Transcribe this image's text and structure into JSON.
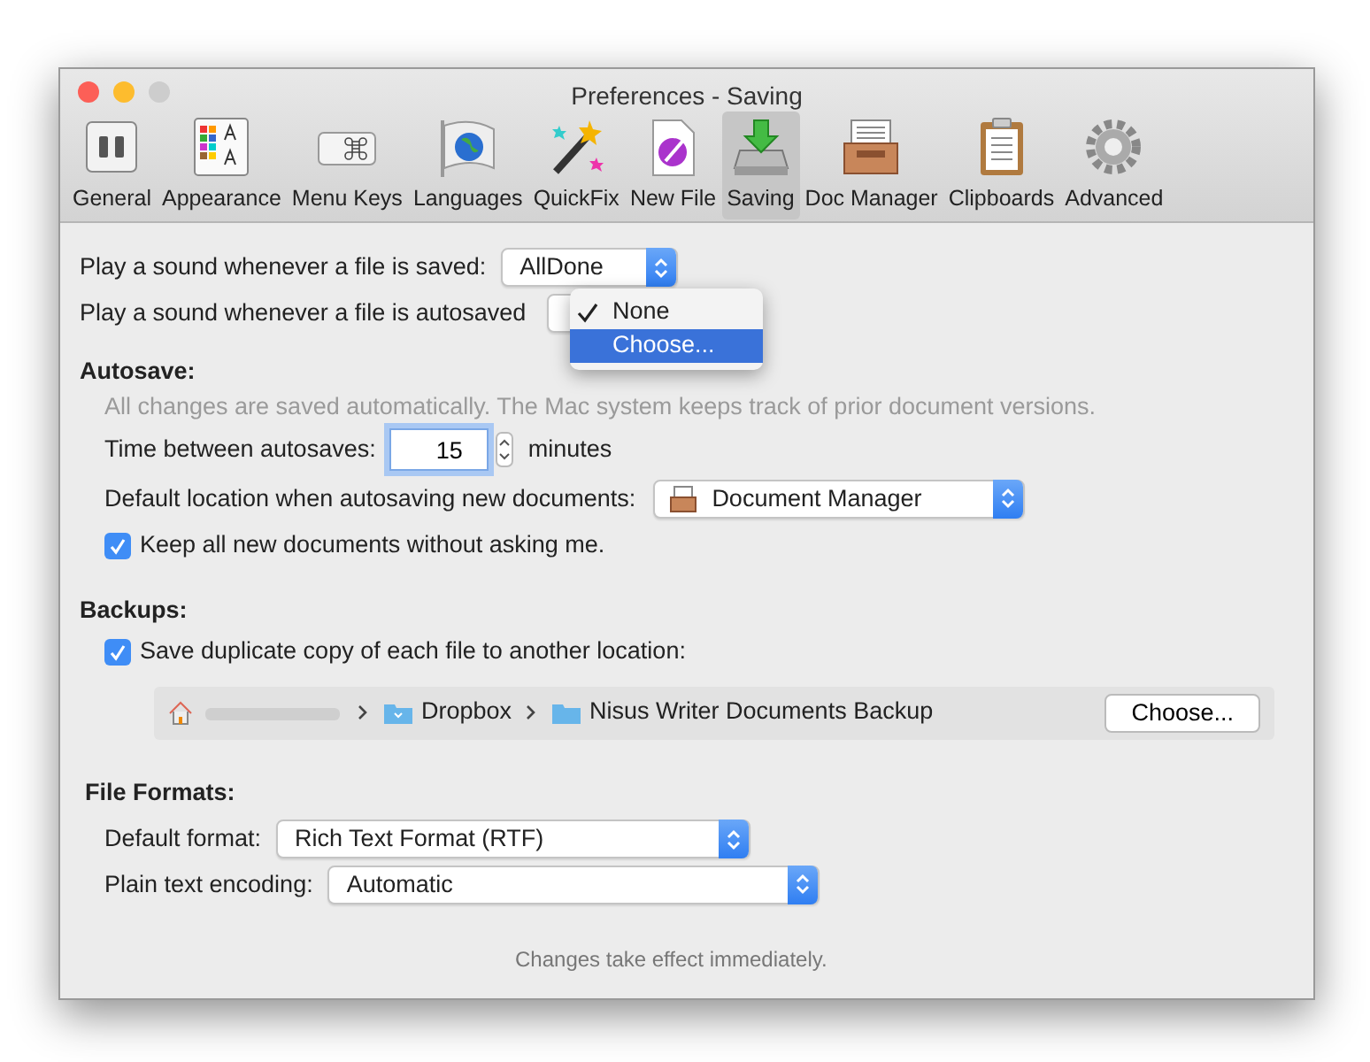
{
  "window": {
    "title": "Preferences - Saving"
  },
  "toolbar": [
    {
      "label": "General",
      "kind": "switches",
      "selected": false
    },
    {
      "label": "Appearance",
      "kind": "palette",
      "selected": false
    },
    {
      "label": "Menu Keys",
      "kind": "key",
      "selected": false
    },
    {
      "label": "Languages",
      "kind": "flag",
      "selected": false
    },
    {
      "label": "QuickFix",
      "kind": "wand",
      "selected": false
    },
    {
      "label": "New File",
      "kind": "newfile",
      "selected": false
    },
    {
      "label": "Saving",
      "kind": "saving",
      "selected": true
    },
    {
      "label": "Doc Manager",
      "kind": "tray",
      "selected": false
    },
    {
      "label": "Clipboards",
      "kind": "clipboard",
      "selected": false
    },
    {
      "label": "Advanced",
      "kind": "gear",
      "selected": false
    }
  ],
  "sound_saved": {
    "label": "Play a sound whenever a file is saved:",
    "value": "AllDone"
  },
  "sound_autosaved": {
    "label": "Play a sound whenever a file is autosaved",
    "menu": [
      {
        "label": "None",
        "checked": true,
        "selected": false
      },
      {
        "label": "Choose...",
        "checked": false,
        "selected": true
      }
    ]
  },
  "autosave": {
    "heading": "Autosave:",
    "note": "All changes are saved automatically. The Mac system keeps track of prior document versions.",
    "interval_label": "Time between autosaves:",
    "interval_value": "15",
    "interval_unit": "minutes",
    "location_label": "Default location when autosaving new documents:",
    "location_value": "Document Manager",
    "keep": {
      "label": "Keep all new documents without asking me.",
      "checked": true
    }
  },
  "backups": {
    "heading": "Backups:",
    "duplicate": {
      "label": "Save duplicate copy of each file to another location:",
      "checked": true
    },
    "path": [
      {
        "label": "Dropbox",
        "kind": "dropbox"
      },
      {
        "label": "Nisus Writer Documents Backup",
        "kind": "folder"
      }
    ],
    "choose": "Choose..."
  },
  "file_formats": {
    "heading": "File Formats:",
    "format_label": "Default format:",
    "format_value": "Rich Text Format (RTF)",
    "encoding_label": "Plain text encoding:",
    "encoding_value": "Automatic"
  },
  "footer": "Changes take effect immediately."
}
